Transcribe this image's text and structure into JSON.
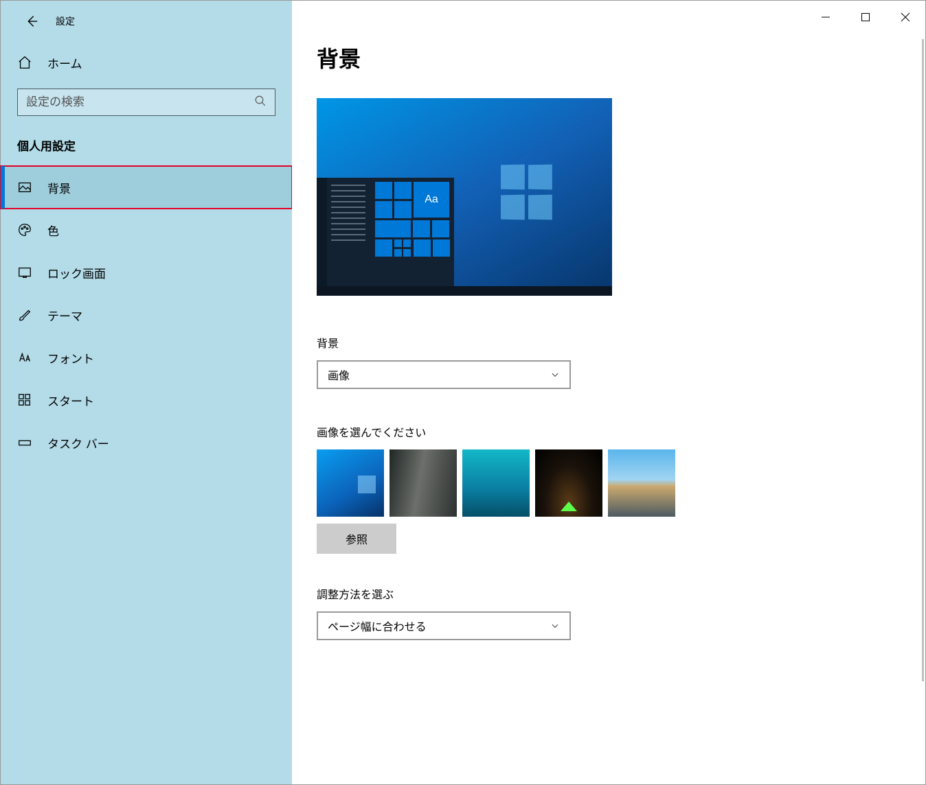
{
  "app_title": "設定",
  "home_label": "ホーム",
  "search_placeholder": "設定の検索",
  "section_title": "個人用設定",
  "nav_items": [
    {
      "id": "background",
      "label": "背景",
      "active": true,
      "highlighted": true
    },
    {
      "id": "colors",
      "label": "色"
    },
    {
      "id": "lockscreen",
      "label": "ロック画面"
    },
    {
      "id": "themes",
      "label": "テーマ"
    },
    {
      "id": "fonts",
      "label": "フォント"
    },
    {
      "id": "start",
      "label": "スタート"
    },
    {
      "id": "taskbar",
      "label": "タスク バー"
    }
  ],
  "page": {
    "heading": "背景",
    "preview_tile_text": "Aa",
    "bg_label": "背景",
    "bg_dropdown_value": "画像",
    "choose_image_label": "画像を選んでください",
    "browse_label": "参照",
    "fit_label": "調整方法を選ぶ",
    "fit_dropdown_value": "ページ幅に合わせる"
  }
}
